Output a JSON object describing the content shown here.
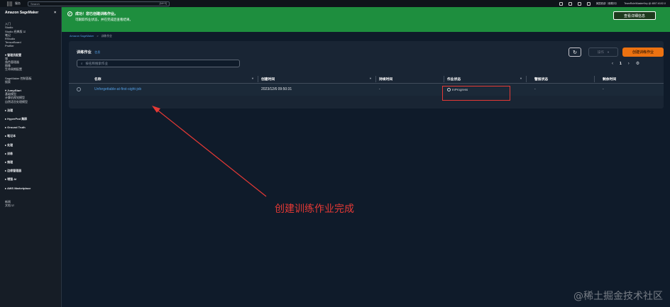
{
  "topnav": {
    "services": "服务",
    "search_placeholder": "Search",
    "shortcut": "[Alt+S]",
    "region": "美国西部（俄勒冈）",
    "account": "TeamRole/MasterKey @ 4807-6102-0"
  },
  "sidebar": {
    "brand": "Amazon SageMaker",
    "close": "×",
    "items": [
      {
        "label": "入门",
        "kind": "item"
      },
      {
        "label": "Studio",
        "kind": "item"
      },
      {
        "label": "Studio 经典版 ☑",
        "kind": "item"
      },
      {
        "label": "笔记",
        "kind": "item"
      },
      {
        "label": "RStudio",
        "kind": "item"
      },
      {
        "label": "TensorBoard",
        "kind": "item"
      },
      {
        "label": "Profiler",
        "kind": "item"
      },
      {
        "label": "",
        "kind": "gap"
      },
      {
        "label": "▾ 管理员配置",
        "kind": "group"
      },
      {
        "label": "域",
        "kind": "item"
      },
      {
        "label": "角色管理器",
        "kind": "item"
      },
      {
        "label": "图像",
        "kind": "item"
      },
      {
        "label": "生命周期配置",
        "kind": "item"
      },
      {
        "label": "",
        "kind": "gap"
      },
      {
        "label": "SageMaker 控制面板",
        "kind": "item"
      },
      {
        "label": "搜索",
        "kind": "item"
      },
      {
        "label": "",
        "kind": "gap"
      },
      {
        "label": "▾ JumpStart",
        "kind": "group"
      },
      {
        "label": "基础模型",
        "kind": "item"
      },
      {
        "label": "计算机视觉模型",
        "kind": "item"
      },
      {
        "label": "自然语言处理模型",
        "kind": "item"
      },
      {
        "label": "",
        "kind": "gap"
      },
      {
        "label": "▸ 治理",
        "kind": "group"
      },
      {
        "label": "",
        "kind": "gap"
      },
      {
        "label": "▸ HyperPod 集群",
        "kind": "group"
      },
      {
        "label": "",
        "kind": "gap"
      },
      {
        "label": "▸ Ground Truth",
        "kind": "group"
      },
      {
        "label": "",
        "kind": "gap"
      },
      {
        "label": "▸ 笔记本",
        "kind": "group"
      },
      {
        "label": "",
        "kind": "gap"
      },
      {
        "label": "▸ 处理",
        "kind": "group"
      },
      {
        "label": "",
        "kind": "gap"
      },
      {
        "label": "▸ 训练",
        "kind": "group"
      },
      {
        "label": "",
        "kind": "gap"
      },
      {
        "label": "▸ 推理",
        "kind": "group"
      },
      {
        "label": "",
        "kind": "gap"
      },
      {
        "label": "▸ 边缘管理器",
        "kind": "group"
      },
      {
        "label": "",
        "kind": "gap"
      },
      {
        "label": "▸ 增强 AI",
        "kind": "group"
      },
      {
        "label": "",
        "kind": "gap"
      },
      {
        "label": "▸ AWS Marketplace",
        "kind": "group"
      },
      {
        "label": "",
        "kind": "gap"
      },
      {
        "label": "",
        "kind": "gap"
      },
      {
        "label": "新闻",
        "kind": "item"
      },
      {
        "label": "文档 ☑",
        "kind": "item"
      }
    ]
  },
  "flash": {
    "title": "成功！您已创建训练作业。",
    "message": "可跟踪作业状态，并在完成后查看结果。",
    "button": "查看详细信息"
  },
  "breadcrumb": {
    "root": "Amazon SageMaker",
    "sep": ">",
    "current": "训练作业"
  },
  "panel": {
    "title": "训练作业",
    "info": "信息",
    "search_placeholder": "按名称搜索作业",
    "refresh_icon": "↻",
    "actions": "操作",
    "actions_caret": "▾",
    "create": "创建训练作业",
    "page": "1",
    "prev": "‹",
    "next": "›",
    "settings_icon": "⚙"
  },
  "table": {
    "columns": [
      "名称",
      "创建时间",
      "持续时间",
      "作业状态",
      "警报状态",
      "剩余时间"
    ],
    "row": {
      "name": "Unforgettable-at-first-sight-job",
      "created": "2023/12/6 09:50:31",
      "duration": "-",
      "status": "InProgress",
      "warning": "-",
      "remaining": "-"
    }
  },
  "annotation": {
    "text": "创建训练作业完成",
    "color": "#e53935"
  },
  "watermark": "@稀土掘金技术社区"
}
